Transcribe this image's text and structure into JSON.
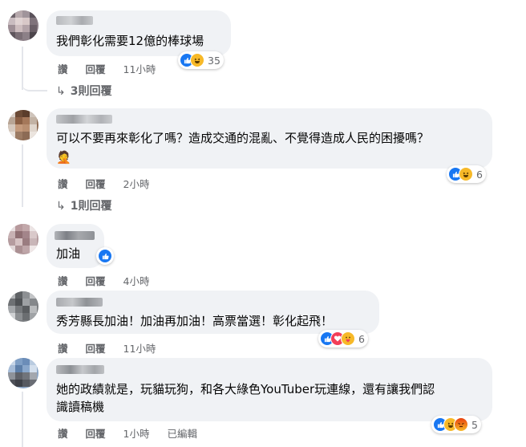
{
  "comments": [
    {
      "text": [
        "我們彰化需要12億的棒球場"
      ],
      "actions": {
        "like": "讚",
        "reply": "回覆",
        "time": "11小時"
      },
      "reaction_count": "35",
      "reactions": [
        "like",
        "haha"
      ],
      "replies": "3則回覆"
    },
    {
      "text": [
        "可以不要再來彰化了嗎？造成交通的混亂、不覺得造成人民的困擾嗎？",
        "🤦"
      ],
      "actions": {
        "like": "讚",
        "reply": "回覆",
        "time": "2小時"
      },
      "reaction_count": "6",
      "reactions": [
        "like",
        "haha"
      ],
      "replies": "1則回覆"
    },
    {
      "text": [
        "加油"
      ],
      "actions": {
        "like": "讚",
        "reply": "回覆",
        "time": "4小時"
      },
      "reaction_count": "",
      "reactions": [
        "like"
      ]
    },
    {
      "text": [
        "秀芳縣長加油！加油再加油！高票當選！彰化起飛！"
      ],
      "actions": {
        "like": "讚",
        "reply": "回覆",
        "time": "11小時"
      },
      "reaction_count": "6",
      "reactions": [
        "like",
        "love",
        "care"
      ]
    },
    {
      "text": [
        "她的政績就是，玩貓玩狗，和各大綠色YouTuber玩連線，還有讓我們認",
        "識讀稿機"
      ],
      "actions": {
        "like": "讚",
        "reply": "回覆",
        "time": "1小時",
        "edited": "已編輯"
      },
      "reaction_count": "5",
      "reactions": [
        "like",
        "haha",
        "angry"
      ]
    }
  ],
  "colors": {
    "like": "#1877f2",
    "haha": "#f7b928",
    "love": "#f33e58",
    "angry": "#e9710f",
    "muted": "#65676b",
    "bubble": "#f0f2f5"
  }
}
